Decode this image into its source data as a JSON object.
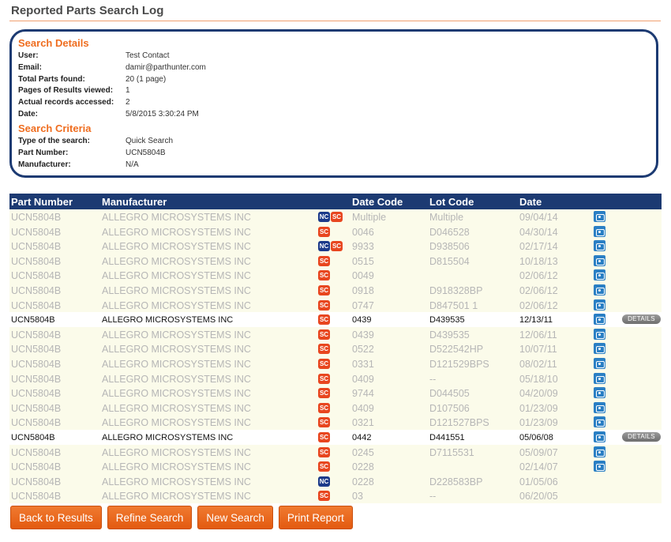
{
  "page_title": "Reported Parts Search Log",
  "search_details": {
    "heading": "Search Details",
    "rows": [
      {
        "label": "User:",
        "value": "Test Contact"
      },
      {
        "label": "Email:",
        "value": "damir@parthunter.com"
      },
      {
        "label": "Total Parts found:",
        "value": "20 (1 page)"
      },
      {
        "label": "Pages of Results viewed:",
        "value": "1"
      },
      {
        "label": "Actual records accessed:",
        "value": "2"
      },
      {
        "label": "Date:",
        "value": "5/8/2015 3:30:24 PM"
      }
    ]
  },
  "search_criteria": {
    "heading": "Search Criteria",
    "rows": [
      {
        "label": "Type of the search:",
        "value": "Quick Search"
      },
      {
        "label": "Part Number:",
        "value": "UCN5804B"
      },
      {
        "label": "Manufacturer:",
        "value": "N/A"
      }
    ]
  },
  "table": {
    "headers": [
      "Part Number",
      "Manufacturer",
      "Date Code",
      "Lot Code",
      "Date"
    ],
    "details_label": "DETAILS",
    "rows": [
      {
        "part": "UCN5804B",
        "mfr": "ALLEGRO MICROSYSTEMS INC",
        "badges": [
          "NC",
          "SC"
        ],
        "code": "Multiple",
        "lot": "Multiple",
        "date": "09/04/14",
        "cam": true,
        "active": false
      },
      {
        "part": "UCN5804B",
        "mfr": "ALLEGRO MICROSYSTEMS INC",
        "badges": [
          "SC"
        ],
        "code": "0046",
        "lot": "D046528",
        "date": "04/30/14",
        "cam": true,
        "active": false
      },
      {
        "part": "UCN5804B",
        "mfr": "ALLEGRO MICROSYSTEMS INC",
        "badges": [
          "NC",
          "SC"
        ],
        "code": "9933",
        "lot": "D938506",
        "date": "02/17/14",
        "cam": true,
        "active": false
      },
      {
        "part": "UCN5804B",
        "mfr": "ALLEGRO MICROSYSTEMS INC",
        "badges": [
          "SC"
        ],
        "code": "0515",
        "lot": "D815504",
        "date": "10/18/13",
        "cam": true,
        "active": false
      },
      {
        "part": "UCN5804B",
        "mfr": "ALLEGRO MICROSYSTEMS INC",
        "badges": [
          "SC"
        ],
        "code": "0049",
        "lot": "",
        "date": "02/06/12",
        "cam": true,
        "active": false
      },
      {
        "part": "UCN5804B",
        "mfr": "ALLEGRO MICROSYSTEMS INC",
        "badges": [
          "SC"
        ],
        "code": "0918",
        "lot": "D918328BP",
        "date": "02/06/12",
        "cam": true,
        "active": false
      },
      {
        "part": "UCN5804B",
        "mfr": "ALLEGRO MICROSYSTEMS INC",
        "badges": [
          "SC"
        ],
        "code": "0747",
        "lot": "D847501 1",
        "date": "02/06/12",
        "cam": true,
        "active": false
      },
      {
        "part": "UCN5804B",
        "mfr": "ALLEGRO MICROSYSTEMS INC",
        "badges": [
          "SC"
        ],
        "code": "0439",
        "lot": "D439535",
        "date": "12/13/11",
        "cam": true,
        "active": true
      },
      {
        "part": "UCN5804B",
        "mfr": "ALLEGRO MICROSYSTEMS INC",
        "badges": [
          "SC"
        ],
        "code": "0439",
        "lot": "D439535",
        "date": "12/06/11",
        "cam": true,
        "active": false
      },
      {
        "part": "UCN5804B",
        "mfr": "ALLEGRO MICROSYSTEMS INC",
        "badges": [
          "SC"
        ],
        "code": "0522",
        "lot": "D522542HP",
        "date": "10/07/11",
        "cam": true,
        "active": false
      },
      {
        "part": "UCN5804B",
        "mfr": "ALLEGRO MICROSYSTEMS INC",
        "badges": [
          "SC"
        ],
        "code": "0331",
        "lot": "D121529BPS",
        "date": "08/02/11",
        "cam": true,
        "active": false
      },
      {
        "part": "UCN5804B",
        "mfr": "ALLEGRO MICROSYSTEMS INC",
        "badges": [
          "SC"
        ],
        "code": "0409",
        "lot": "--",
        "date": "05/18/10",
        "cam": true,
        "active": false
      },
      {
        "part": "UCN5804B",
        "mfr": "ALLEGRO MICROSYSTEMS INC",
        "badges": [
          "SC"
        ],
        "code": "9744",
        "lot": "D044505",
        "date": "04/20/09",
        "cam": true,
        "active": false
      },
      {
        "part": "UCN5804B",
        "mfr": "ALLEGRO MICROSYSTEMS INC",
        "badges": [
          "SC"
        ],
        "code": "0409",
        "lot": "D107506",
        "date": "01/23/09",
        "cam": true,
        "active": false
      },
      {
        "part": "UCN5804B",
        "mfr": "ALLEGRO MICROSYSTEMS INC",
        "badges": [
          "SC"
        ],
        "code": "0321",
        "lot": "D121527BPS",
        "date": "01/23/09",
        "cam": true,
        "active": false
      },
      {
        "part": "UCN5804B",
        "mfr": "ALLEGRO MICROSYSTEMS INC",
        "badges": [
          "SC"
        ],
        "code": "0442",
        "lot": "D441551",
        "date": "05/06/08",
        "cam": true,
        "active": true
      },
      {
        "part": "UCN5804B",
        "mfr": "ALLEGRO MICROSYSTEMS INC",
        "badges": [
          "SC"
        ],
        "code": "0245",
        "lot": "D7115531",
        "date": "05/09/07",
        "cam": true,
        "active": false
      },
      {
        "part": "UCN5804B",
        "mfr": "ALLEGRO MICROSYSTEMS INC",
        "badges": [
          "SC"
        ],
        "code": "0228",
        "lot": "",
        "date": "02/14/07",
        "cam": true,
        "active": false
      },
      {
        "part": "UCN5804B",
        "mfr": "ALLEGRO MICROSYSTEMS INC",
        "badges": [
          "NC"
        ],
        "code": "0228",
        "lot": "D228583BP",
        "date": "01/05/06",
        "cam": false,
        "active": false
      },
      {
        "part": "UCN5804B",
        "mfr": "ALLEGRO MICROSYSTEMS INC",
        "badges": [
          "SC"
        ],
        "code": "03",
        "lot": "--",
        "date": "06/20/05",
        "cam": false,
        "active": false
      }
    ]
  },
  "buttons": {
    "back": "Back to Results",
    "refine": "Refine Search",
    "new": "New Search",
    "print": "Print Report"
  },
  "colors": {
    "accent": "#ef6d1f",
    "header_bg": "#1c3a72",
    "sc_badge": "#e8461f",
    "nc_badge": "#1c3a8a",
    "camera": "#2a7fc4"
  },
  "icons": {
    "camera": "camera-icon",
    "sc_badge": "sc-badge-icon",
    "nc_badge": "nc-badge-icon"
  }
}
